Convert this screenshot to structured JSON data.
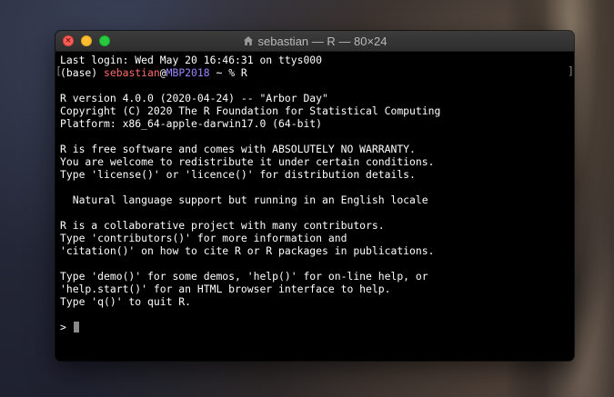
{
  "window": {
    "title": "sebastian — R — 80×24"
  },
  "terminal": {
    "login_line": "Last login: Wed May 20 16:46:31 on ttys000",
    "prompt": {
      "env": "(base) ",
      "user": "sebastian",
      "at": "@",
      "host": "MBP2018",
      "rest": " ~ % R"
    },
    "lines": [
      "",
      "R version 4.0.0 (2020-04-24) -- \"Arbor Day\"",
      "Copyright (C) 2020 The R Foundation for Statistical Computing",
      "Platform: x86_64-apple-darwin17.0 (64-bit)",
      "",
      "R is free software and comes with ABSOLUTELY NO WARRANTY.",
      "You are welcome to redistribute it under certain conditions.",
      "Type 'license()' or 'licence()' for distribution details.",
      "",
      "  Natural language support but running in an English locale",
      "",
      "R is a collaborative project with many contributors.",
      "Type 'contributors()' for more information and",
      "'citation()' on how to cite R or R packages in publications.",
      "",
      "Type 'demo()' for some demos, 'help()' for on-line help, or",
      "'help.start()' for an HTML browser interface to help.",
      "Type 'q()' to quit R.",
      ""
    ],
    "r_prompt": "> "
  },
  "colors": {
    "user": "#ff6b6b",
    "host": "#9b86ff",
    "text": "#ffffff",
    "background": "#000000"
  },
  "icons": {
    "title_icon": "home-folder-icon",
    "close": "close-icon"
  }
}
